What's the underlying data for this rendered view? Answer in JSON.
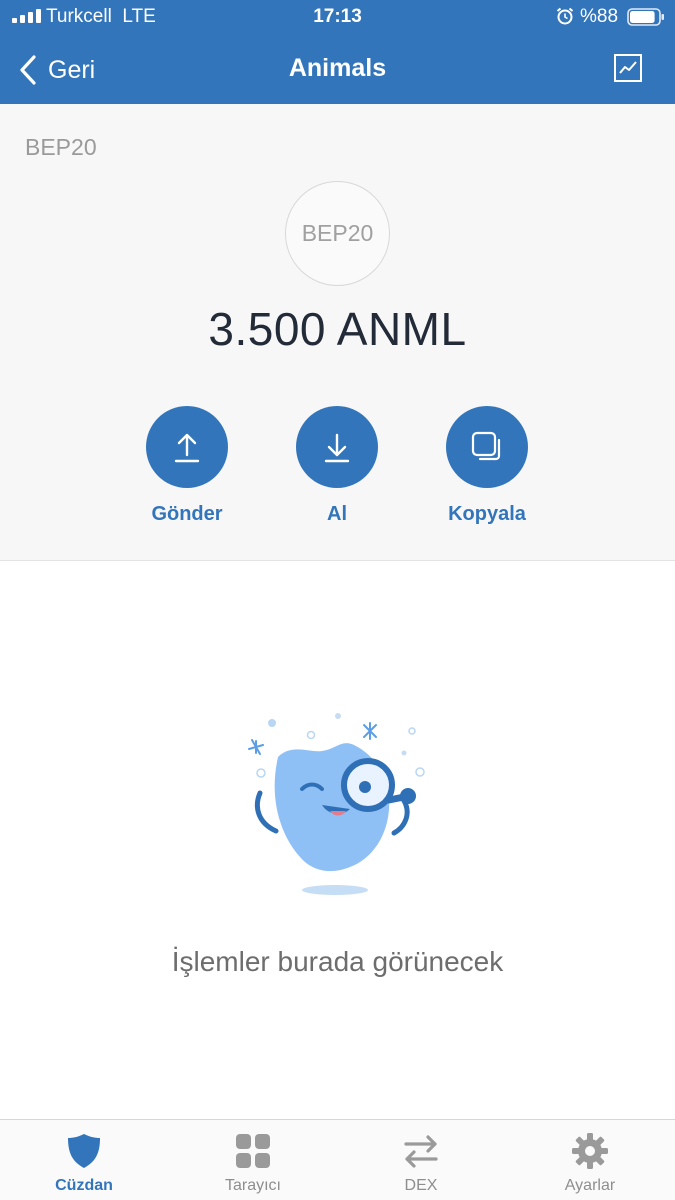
{
  "status_bar": {
    "carrier": "Turkcell",
    "network_type": "LTE",
    "time": "17:13",
    "battery": "%88",
    "battery_level": 0.88
  },
  "nav": {
    "back_label": "Geri",
    "title": "Animals",
    "chart_icon": "chart-icon"
  },
  "token": {
    "network_label": "BEP20",
    "avatar_text": "BEP20",
    "balance": "3.500 ANML"
  },
  "actions": [
    {
      "label": "Gönder",
      "icon": "send-arrow-up-icon"
    },
    {
      "label": "Al",
      "icon": "receive-arrow-down-icon"
    },
    {
      "label": "Kopyala",
      "icon": "copy-icon"
    }
  ],
  "empty_state": {
    "message": "İşlemler burada görünecek",
    "illustration": "mascot-magnifier-illustration"
  },
  "tab_bar": [
    {
      "label": "Cüzdan",
      "icon": "shield-icon",
      "active": true
    },
    {
      "label": "Tarayıcı",
      "icon": "grid-icon",
      "active": false
    },
    {
      "label": "DEX",
      "icon": "swap-arrows-icon",
      "active": false
    },
    {
      "label": "Ayarlar",
      "icon": "gear-icon",
      "active": false
    }
  ],
  "colors": {
    "brand": "#3375bb",
    "balance_text": "#232a38",
    "muted_text": "#8e8e8e",
    "section_bg": "#f7f7f7"
  }
}
